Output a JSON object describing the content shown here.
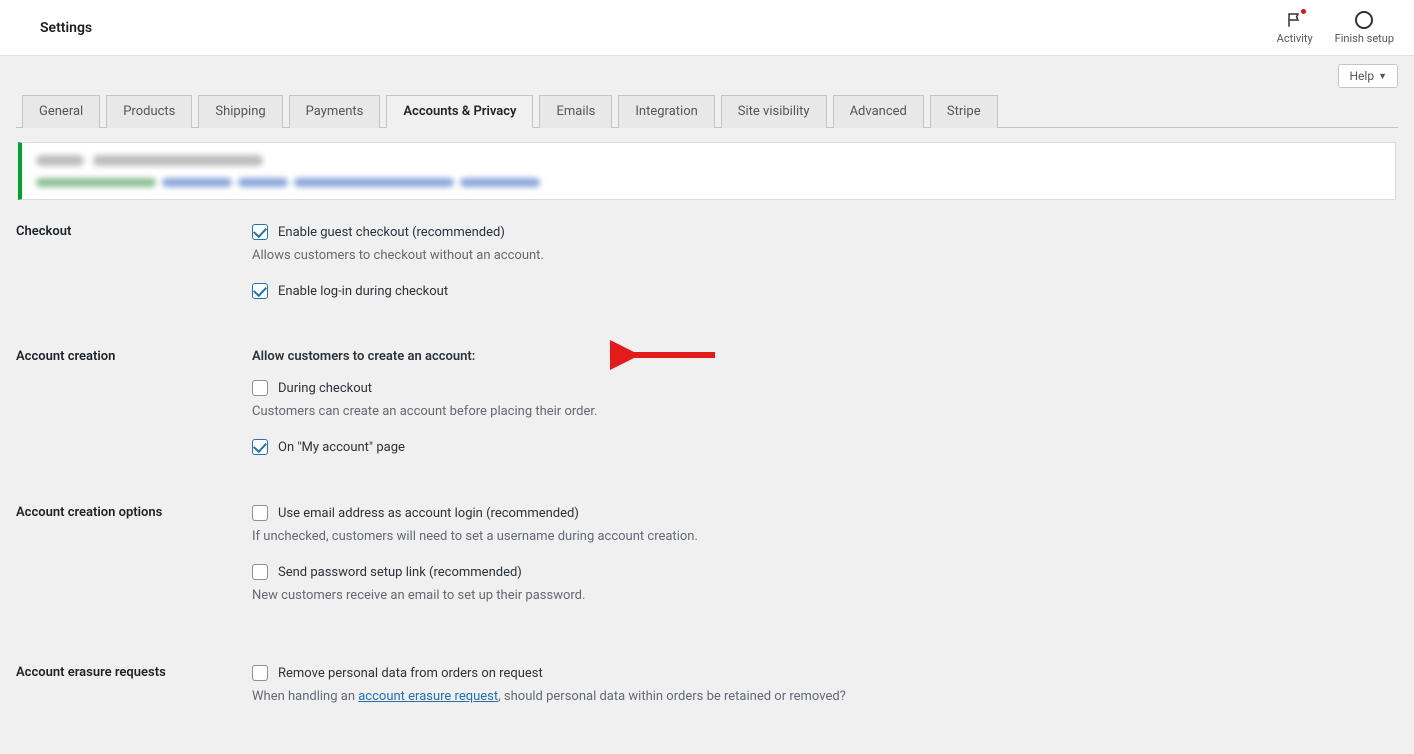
{
  "topbar": {
    "title": "Settings",
    "activity_label": "Activity",
    "finish_label": "Finish setup"
  },
  "help_label": "Help",
  "tabs": [
    "General",
    "Products",
    "Shipping",
    "Payments",
    "Accounts & Privacy",
    "Emails",
    "Integration",
    "Site visibility",
    "Advanced",
    "Stripe"
  ],
  "active_tab_index": 4,
  "sections": {
    "checkout": {
      "label": "Checkout",
      "guest_checkout": "Enable guest checkout (recommended)",
      "guest_desc": "Allows customers to checkout without an account.",
      "login_checkout": "Enable log-in during checkout"
    },
    "account_creation": {
      "label": "Account creation",
      "heading": "Allow customers to create an account:",
      "during_checkout": "During checkout",
      "during_desc": "Customers can create an account before placing their order.",
      "on_my_account": "On \"My account\" page"
    },
    "account_options": {
      "label": "Account creation options",
      "use_email": "Use email address as account login (recommended)",
      "use_email_desc": "If unchecked, customers will need to set a username during account creation.",
      "send_pw": "Send password setup link (recommended)",
      "send_pw_desc": "New customers receive an email to set up their password."
    },
    "erasure": {
      "label": "Account erasure requests",
      "remove_data": "Remove personal data from orders on request",
      "desc_pre": "When handling an ",
      "desc_link": "account erasure request",
      "desc_post": ", should personal data within orders be retained or removed?"
    }
  }
}
